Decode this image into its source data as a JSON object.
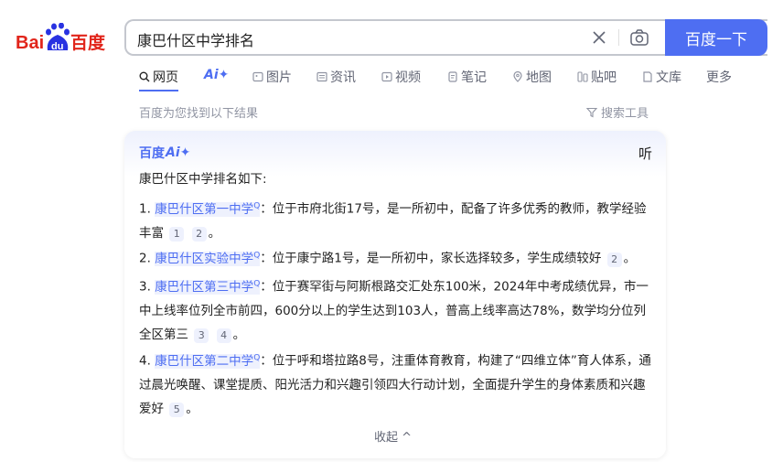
{
  "logo": {
    "text_bai": "Bai",
    "text_du": "du",
    "text_baidu_cn": "百度"
  },
  "search": {
    "query": "康巴什区中学排名",
    "button_label": "百度一下"
  },
  "tabs": [
    {
      "label": "网页",
      "icon": "search-icon"
    },
    {
      "label": "Ai✦",
      "icon": ""
    },
    {
      "label": "图片",
      "icon": "image-icon"
    },
    {
      "label": "资讯",
      "icon": "news-icon"
    },
    {
      "label": "视频",
      "icon": "video-icon"
    },
    {
      "label": "笔记",
      "icon": "note-icon"
    },
    {
      "label": "地图",
      "icon": "map-icon"
    },
    {
      "label": "贴吧",
      "icon": "tieba-icon"
    },
    {
      "label": "文库",
      "icon": "wenku-icon"
    },
    {
      "label": "更多",
      "icon": ""
    }
  ],
  "results_info": {
    "found_text": "百度为您找到以下结果",
    "tools_label": "搜索工具"
  },
  "ai_card": {
    "brand": "百度",
    "brand_ai": "Ai✦",
    "listen_label": "听",
    "intro": "康巴什区中学排名如下:",
    "items": [
      {
        "num": "1.",
        "school": "康巴什区第一中学",
        "text": "：位于市府北街17号，是一所初中，配备了许多优秀的教师，教学经验丰富",
        "cites": [
          "1",
          "2"
        ]
      },
      {
        "num": "2.",
        "school": "康巴什区实验中学",
        "text": "：位于康宁路1号，是一所初中，家长选择较多，学生成绩较好",
        "cites": [
          "2"
        ]
      },
      {
        "num": "3.",
        "school": "康巴什区第三中学",
        "text": "：位于赛罕街与阿斯根路交汇处东100米，2024年中考成绩优异，市一中上线率位列全市前四，600分以上的学生达到103人，普高上线率高达78%，数学均分位列全区第三",
        "cites": [
          "3",
          "4"
        ]
      },
      {
        "num": "4.",
        "school": "康巴什区第二中学",
        "text": "：位于呼和塔拉路8号，注重体育教育，构建了“四维立体”育人体系，通过晨光唤醒、课堂提质、阳光活力和兴趣引领四大行动计划，全面提升学生的身体素质和兴趣爱好",
        "cites": [
          "5"
        ]
      }
    ],
    "collapse_label": "收起 ^"
  },
  "colors": {
    "accent": "#4e6ef2",
    "logo_red": "#e1251b",
    "text_gray": "#9195a3"
  }
}
